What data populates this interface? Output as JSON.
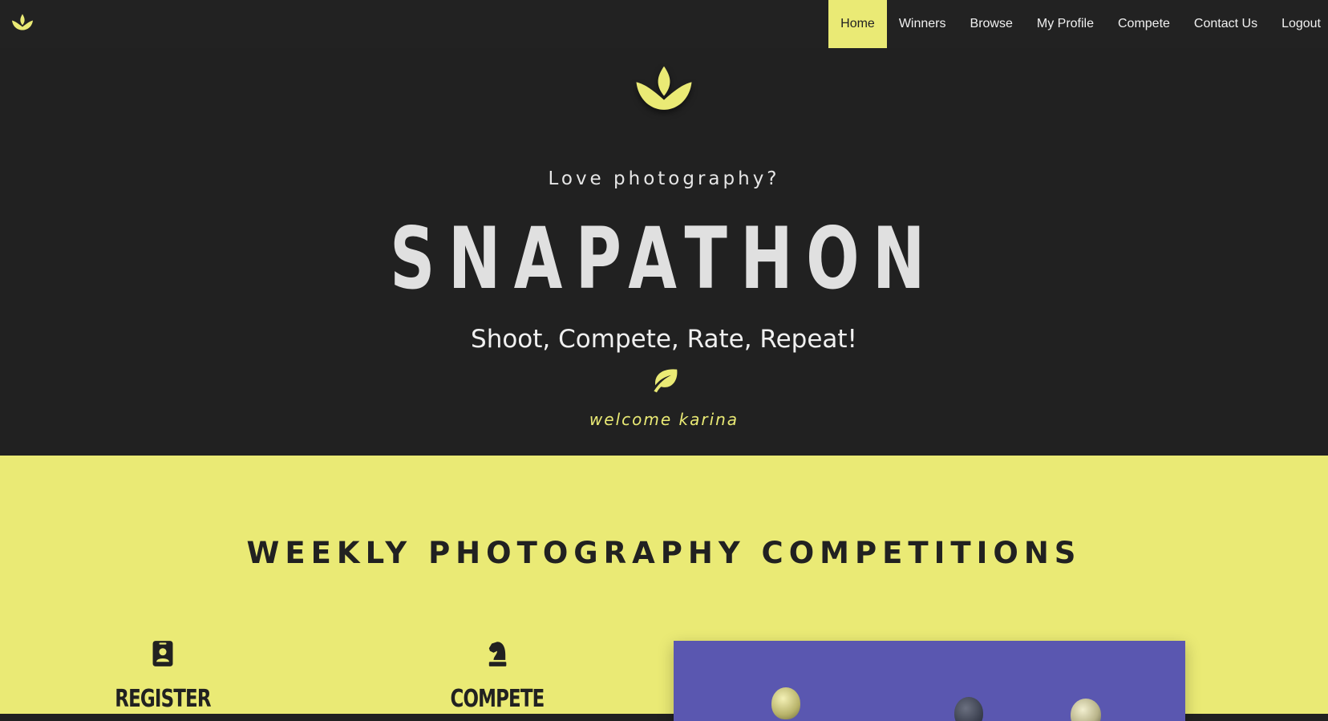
{
  "nav": {
    "items": [
      {
        "label": "Home",
        "active": true
      },
      {
        "label": "Winners"
      },
      {
        "label": "Browse"
      },
      {
        "label": "My Profile"
      },
      {
        "label": "Compete"
      },
      {
        "label": "Contact Us"
      },
      {
        "label": "Logout"
      }
    ]
  },
  "hero": {
    "tagline": "Love photography?",
    "brand": "SNAPATHON",
    "slogan": "Shoot, Compete, Rate, Repeat!",
    "welcome": "welcome karina"
  },
  "section": {
    "title": "WEEKLY PHOTOGRAPHY COMPETITIONS",
    "steps": [
      {
        "label": "REGISTER",
        "icon": "id-badge-icon"
      },
      {
        "label": "COMPETE",
        "icon": "chess-knight-icon"
      }
    ],
    "photo": "hot-air-balloons-image"
  },
  "colors": {
    "accent": "#eaea75",
    "dark": "#212121",
    "photo_sky": "#5a57b0"
  }
}
